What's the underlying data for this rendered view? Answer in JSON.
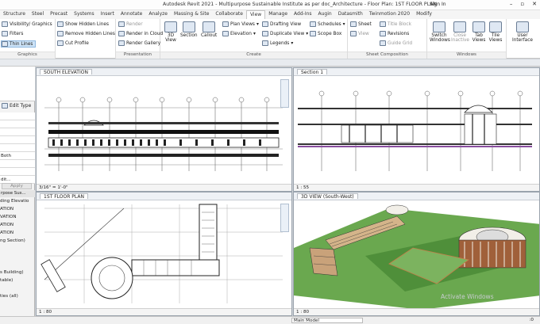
{
  "app": {
    "title": "Autodesk Revit 2021 - Multipurpose Sustainable Institute as per doc_Architecture - Floor Plan: 1ST FLOOR PLAN",
    "sign_in": "Sign In"
  },
  "tabs": [
    "Structure",
    "Steel",
    "Precast",
    "Systems",
    "Insert",
    "Annotate",
    "Analyze",
    "Massing & Site",
    "Collaborate",
    "View",
    "Manage",
    "Add-Ins",
    "Augin",
    "Datasmith",
    "Twinmotion 2020",
    "Modify"
  ],
  "active_tab": "View",
  "ribbon": {
    "graphics": {
      "label": "Graphics",
      "visibility": "Visibility/ Graphics",
      "filters": "Filters",
      "thin_lines": "Thin Lines",
      "show_hidden": "Show Hidden Lines",
      "remove_hidden": "Remove Hidden Lines",
      "cut_profile": "Cut Profile"
    },
    "presentation": {
      "label": "Presentation",
      "render": "Render",
      "render_cloud": "Render in Cloud",
      "render_gallery": "Render Gallery"
    },
    "create": {
      "label": "Create",
      "view3d": "3D View",
      "section": "Section",
      "callout": "Callout",
      "plan_views": "Plan Views",
      "elevation": "Elevation",
      "drafting_view": "Drafting View",
      "duplicate_view": "Duplicate View",
      "legends": "Legends",
      "schedules": "Schedules",
      "scope_box": "Scope Box"
    },
    "sheet_composition": {
      "label": "Sheet Composition",
      "sheet": "Sheet",
      "title_block": "Title Block",
      "view": "View",
      "revisions": "Revisions",
      "guide_grid": "Guide Grid"
    },
    "windows": {
      "label": "Windows",
      "switch_windows": "Switch Windows",
      "close_inactive": "Close Inactive",
      "tab_views": "Tab Views",
      "tile_views": "Tile Views",
      "user_interface": "User Interface"
    }
  },
  "properties": {
    "edit_type": "Edit Type",
    "rows": [
      "",
      "",
      "",
      "",
      "",
      "Both",
      "",
      "",
      "dit..."
    ],
    "apply": "Apply",
    "browser_header": "rpose Sus...",
    "browser_items": [
      "ding Elevatio",
      "ATION",
      "VATION",
      "ATION",
      "ATION",
      "ng Section)",
      "",
      "",
      "",
      "s Building)",
      "table)",
      "",
      "ties (all)"
    ]
  },
  "views": {
    "south_elevation": {
      "tab": "SOUTH ELEVATION",
      "scale": "3/16\" = 1'-0\""
    },
    "section1": {
      "tab": "Section 1",
      "scale": "1 : 55"
    },
    "floor_plan": {
      "tab": "1ST FLOOR PLAN",
      "scale": "1 : 80"
    },
    "view3d": {
      "tab": "3D VIEW (South-West)",
      "scale": "1 : 80"
    }
  },
  "status": {
    "main_model": "Main Model",
    "filter": ":0"
  },
  "watermark": "Activate Windows",
  "colors": {
    "accent": "#2b79c2",
    "grass": "#6aa84f",
    "ribbon_bg": "#ffffff"
  }
}
